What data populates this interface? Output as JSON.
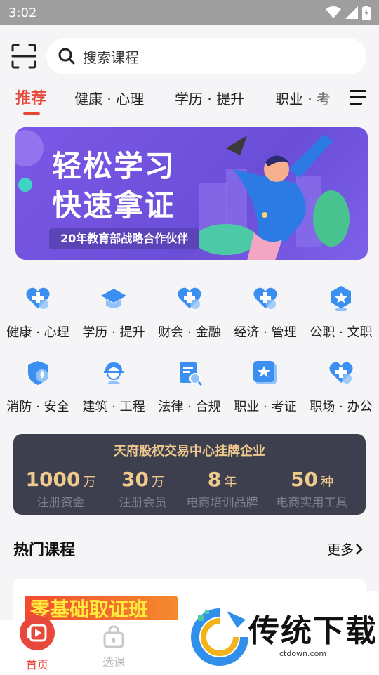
{
  "status_bar": {
    "time": "3:02"
  },
  "search": {
    "placeholder": "搜索课程"
  },
  "tabs": [
    {
      "label": "推荐",
      "active": true
    },
    {
      "label": "健康 · 心理",
      "active": false
    },
    {
      "label": "学历 · 提升",
      "active": false
    },
    {
      "label": "职业 · 考"
    }
  ],
  "banner": {
    "title_line1": "轻松学习",
    "title_line2": "快速拿证",
    "subtitle": "20年教育部战略合作伙伴"
  },
  "categories": [
    {
      "label": "健康 · 心理",
      "icon": "heart-plus-icon"
    },
    {
      "label": "学历 · 提升",
      "icon": "graduation-cap-icon"
    },
    {
      "label": "财会 · 金融",
      "icon": "heart-plus-icon"
    },
    {
      "label": "经济 · 管理",
      "icon": "heart-plus-icon"
    },
    {
      "label": "公职 · 文职",
      "icon": "badge-star-icon"
    },
    {
      "label": "消防 · 安全",
      "icon": "shield-drop-icon"
    },
    {
      "label": "建筑 · 工程",
      "icon": "worker-icon"
    },
    {
      "label": "法律 · 合规",
      "icon": "document-search-icon"
    },
    {
      "label": "职业 · 考证",
      "icon": "certificate-star-icon"
    },
    {
      "label": "职场 · 办公",
      "icon": "heart-plus-icon"
    }
  ],
  "stats": {
    "title": "天府股权交易中心挂牌企业",
    "items": [
      {
        "value": "1000",
        "unit": "万",
        "caption": "注册资金"
      },
      {
        "value": "30",
        "unit": "万",
        "caption": "注册会员"
      },
      {
        "value": "8",
        "unit": "年",
        "caption": "电商培训品牌"
      },
      {
        "value": "50",
        "unit": "种",
        "caption": "电商实用工具"
      }
    ]
  },
  "hot_courses": {
    "title": "热门课程",
    "more": "更多",
    "first_thumb_text": "零基础取证班"
  },
  "bottom_nav": [
    {
      "label": "首页",
      "active": true
    },
    {
      "label": "选课",
      "active": false
    }
  ],
  "watermark": {
    "text": "传统下载",
    "sub": "ctdown.com"
  },
  "colors": {
    "accent": "#e8473b",
    "banner": "#7c58e6",
    "stats_bg": "#3d3f4e",
    "stats_text": "#f0c98d",
    "category_icon": "#3b8ff0"
  }
}
